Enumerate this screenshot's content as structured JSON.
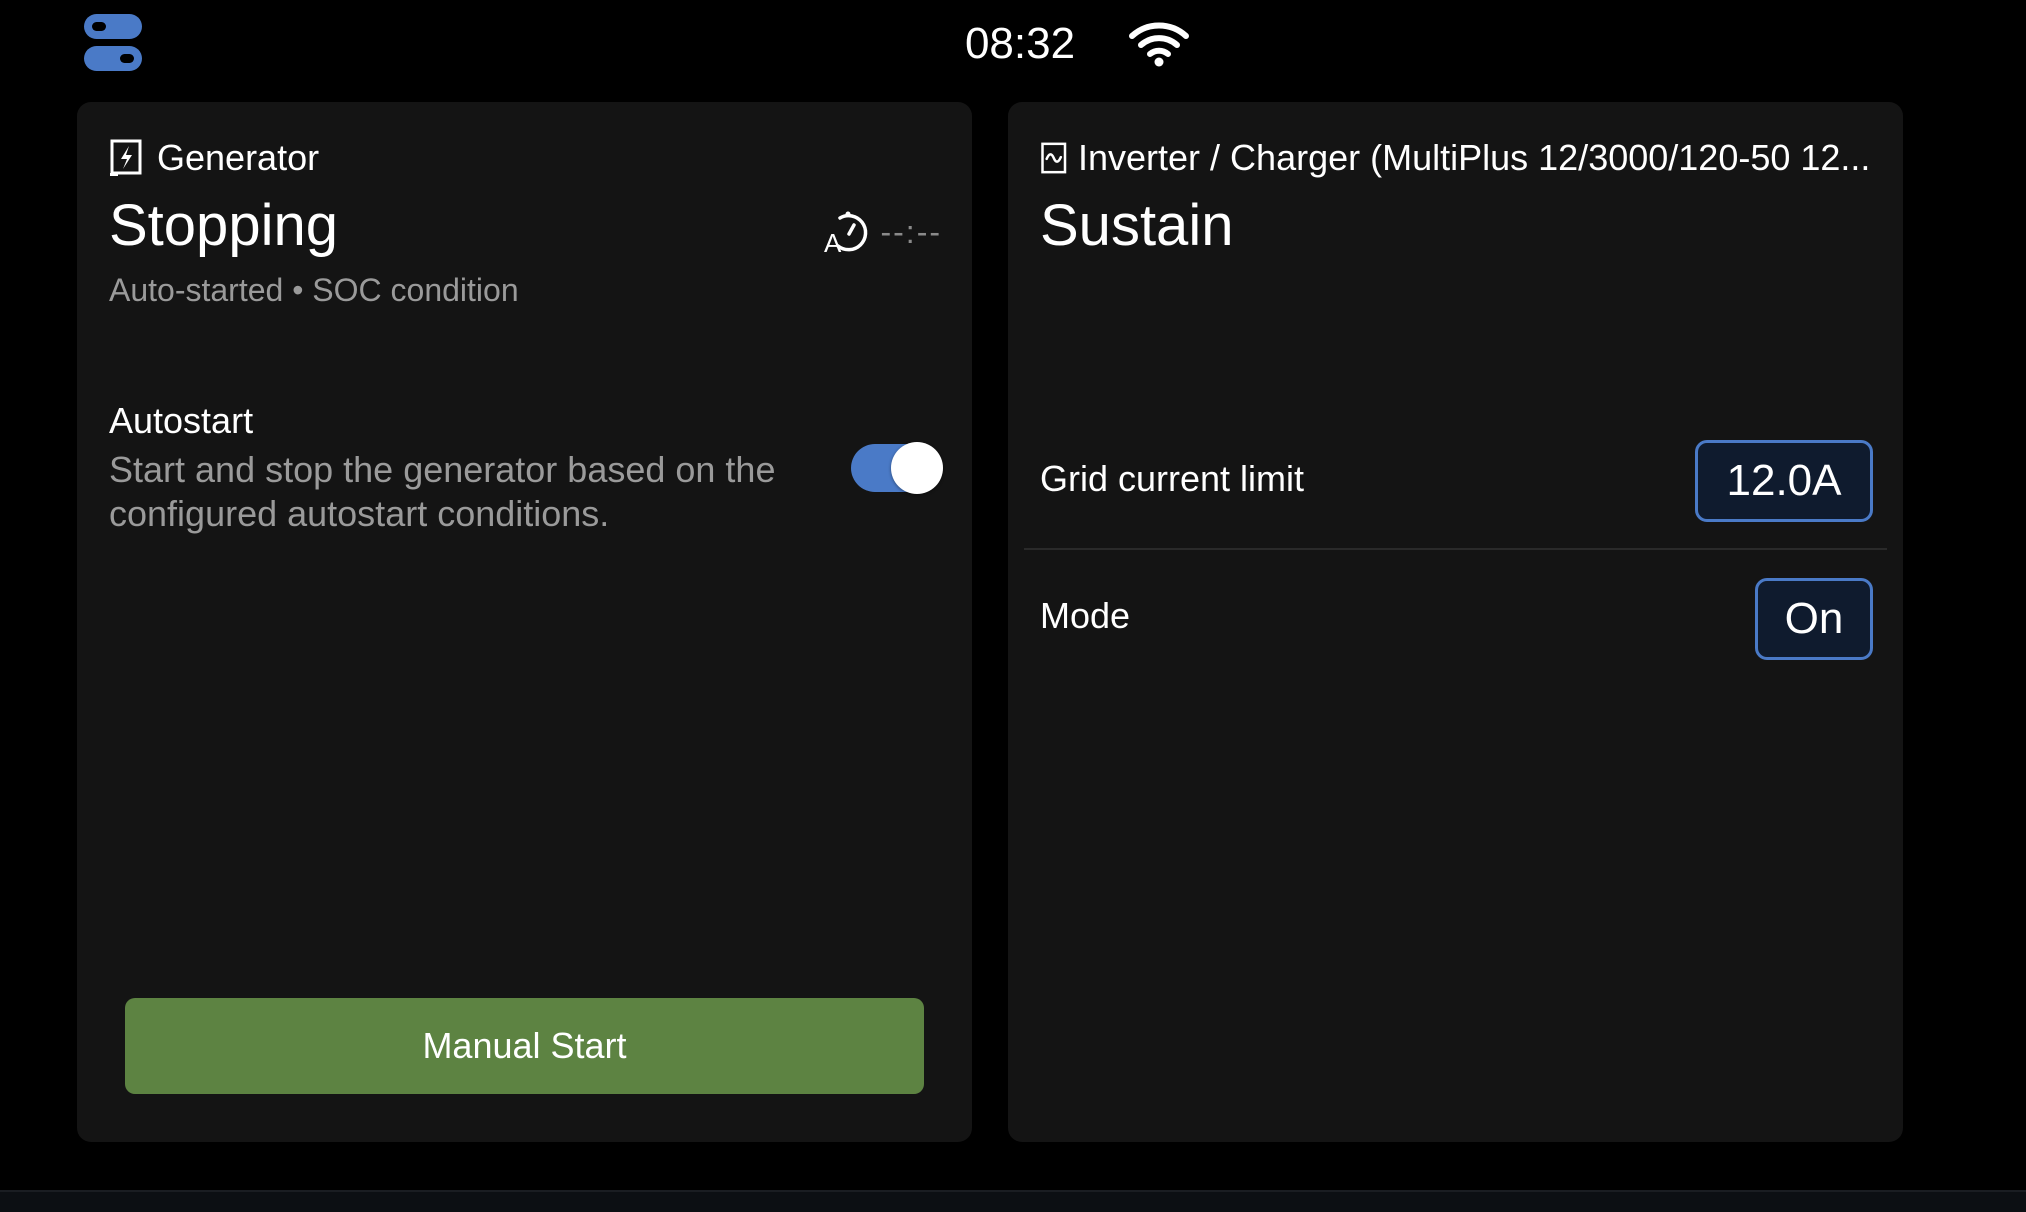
{
  "statusbar": {
    "controls_icon": "controls-toggle-icon",
    "time": "08:32",
    "wifi_icon": "wifi-icon"
  },
  "generator": {
    "icon": "generator-icon",
    "title": "Generator",
    "state": "Stopping",
    "substate": "Auto-started • SOC condition",
    "runtime_icon": "auto-timer-icon",
    "runtime": "--:--",
    "autostart": {
      "title": "Autostart",
      "description": "Start and stop the generator based on the configured autostart conditions.",
      "enabled": true
    },
    "manual_start_label": "Manual Start"
  },
  "inverter": {
    "icon": "inverter-icon",
    "title": "Inverter / Charger (MultiPlus 12/3000/120-50 12...",
    "state": "Sustain",
    "settings": [
      {
        "label": "Grid current limit",
        "value": "12.0A"
      },
      {
        "label": "Mode",
        "value": "On"
      }
    ]
  },
  "colors": {
    "background": "#000000",
    "card": "#141414",
    "accent_blue": "#4a7ac7",
    "button_green": "#5d8342",
    "secondary_text": "#9a9a9a"
  }
}
